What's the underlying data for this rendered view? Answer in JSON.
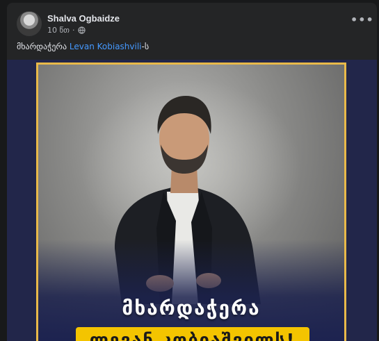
{
  "post": {
    "author": "Shalva Ogbaidze",
    "timestamp": "10 წთ",
    "separator": "·",
    "privacy_icon": "globe-icon",
    "more_icon": "more-options-icon",
    "more_label": "•••",
    "caption": {
      "prefix": "მხარდაჭერა ",
      "mention": "Levan Kobiashvili",
      "suffix": "-ს"
    }
  },
  "media": {
    "headline": "მხარდაჭერა",
    "banner": "ლევან კობიაშვილს!",
    "colors": {
      "frame_border": "#e9b949",
      "banner_bg": "#f4c400",
      "background": "#22264a",
      "mention": "#4599ff"
    }
  }
}
